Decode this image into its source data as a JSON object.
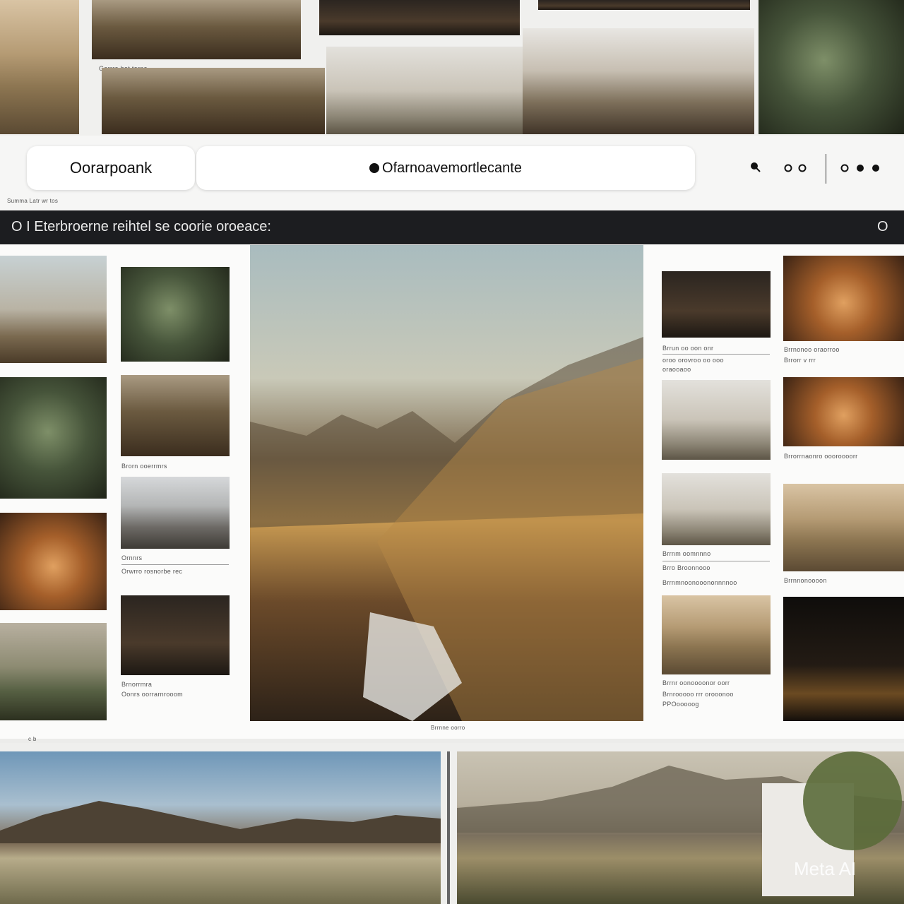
{
  "toolbar": {
    "brand": "Oorarpoank",
    "search": "Ofarnoavemortlecante",
    "sub_link": "Summa   Latr wr tos"
  },
  "banner": {
    "title": "O I Eterbroerne reihtel se coorie oroeace:",
    "right_glyph": "O"
  },
  "captions": {
    "top_strip": "Garrre bet terpe",
    "left_2_title": "Brorn ooerrmrs",
    "left_3_title": "Ornnrs",
    "left_3_sub": "Orwrro rosnorbe rec",
    "left_4_title": "Brnorrmra",
    "left_4_sub": "Oonrs oorrarnrooom",
    "right_1_title": "Brrun oo oon onr",
    "right_1_sub": "oroo orovroo oo ooo",
    "right_1_sub2": "oraooaoo",
    "right_2_title": "Brrnonoo oraorroo",
    "right_2_sub": "Brrorr  v  rrr",
    "right_3_title": "Brrorrnaonro oooroooorr",
    "right_4_title": "Brrnm oomnnno",
    "right_4_sub": "Brro Broonnooo",
    "right_4_sub2": "Brrnmnoonooononnnnoo",
    "right_5_title": "Brrnnonoooon",
    "right_6_title": "Brrnr oonoooonor oorr",
    "right_6_sub": "Brnrooooo rrr orooonoo",
    "right_6_sub2": "PPOooooog",
    "center_caption": "Brrnne oorro",
    "left_foot": "c b"
  },
  "watermark": "Meta AI",
  "icons": {
    "search": "search-icon",
    "toggle": "toggle-icon",
    "menu": "more-icon",
    "info": "info-icon"
  },
  "colors": {
    "banner_bg": "#1c1d20",
    "panel_bg": "#fbfbfa",
    "page_bg": "#ececea"
  }
}
